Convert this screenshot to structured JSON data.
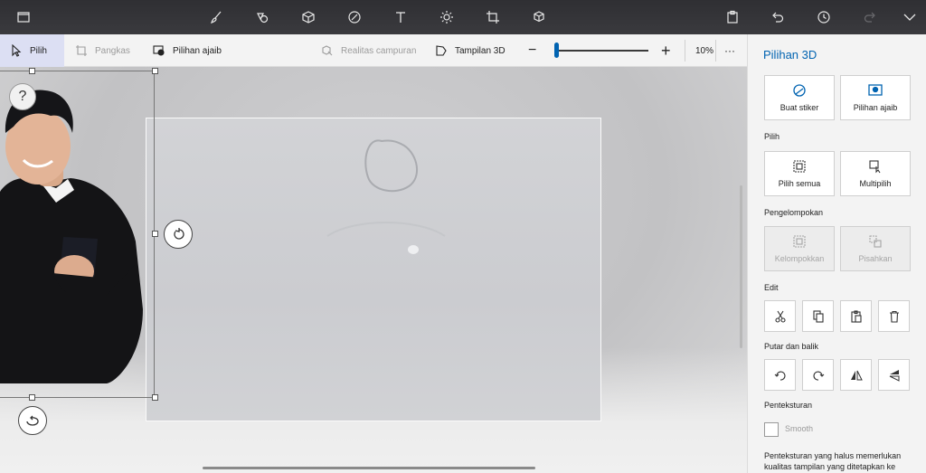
{
  "toolbar": {
    "icons": [
      "menu-folder-icon",
      "brushes-icon",
      "2d-shapes-icon",
      "3d-shapes-icon",
      "stickers-icon",
      "text-icon",
      "effects-icon",
      "canvas-icon",
      "3d-library-icon",
      "paste-icon",
      "undo-icon",
      "history-icon",
      "redo-icon",
      "expand-icon"
    ]
  },
  "subbar": {
    "select_label": "Pilih",
    "crop_label": "Pangkas",
    "magic_label": "Pilihan ajaib",
    "mixed_reality_label": "Realitas campuran",
    "view3d_label": "Tampilan 3D",
    "zoom_value": "10%",
    "zoom_level_percent": 10,
    "more_label": "···"
  },
  "canvas": {
    "help_label": "?"
  },
  "panel": {
    "title": "Pilihan 3D",
    "make_sticker": "Buat stiker",
    "magic_select": "Pilihan ajaib",
    "section_select": "Pilih",
    "select_all": "Pilih semua",
    "multiselect": "Multipilih",
    "section_group": "Pengelompokan",
    "group": "Kelompokkan",
    "ungroup": "Pisahkan",
    "section_edit": "Edit",
    "section_rotate": "Putar dan balik",
    "section_texture": "Penteksturan",
    "smooth_label": "Smooth",
    "note": "Penteksturan yang halus memerlukan kualitas tampilan yang ditetapkan ke"
  },
  "colors": {
    "accent": "#0063b1",
    "topbar": "#333336",
    "panel_bg": "#f3f3f3"
  }
}
